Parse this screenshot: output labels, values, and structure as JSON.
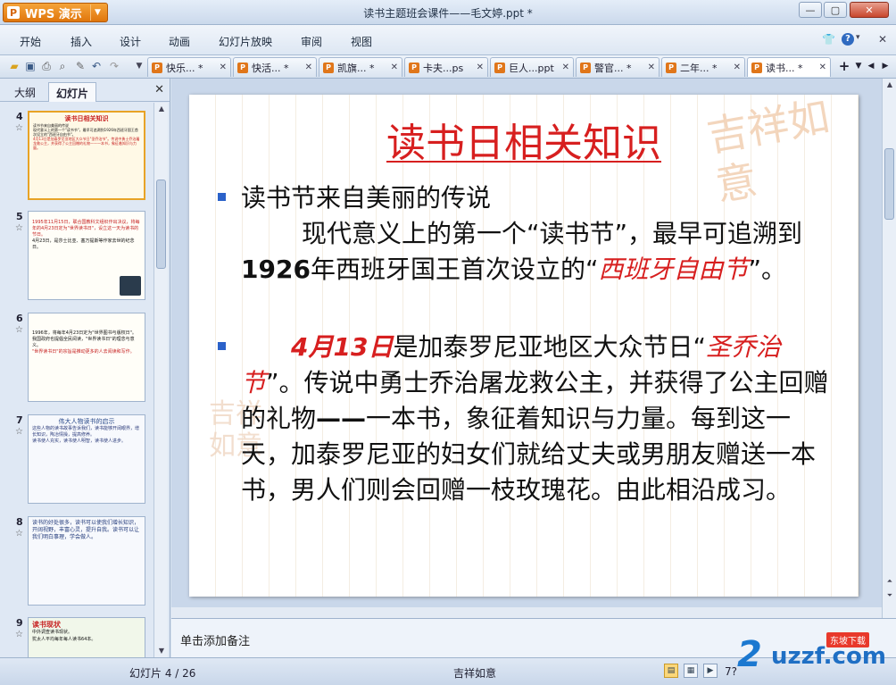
{
  "app": {
    "name": "WPS 演示",
    "doc_title": "读书主题班会课件——毛文婷.ppt *"
  },
  "window_controls": {
    "minimize": "—",
    "maximize": "▢",
    "close": "✕"
  },
  "menu": [
    "开始",
    "插入",
    "设计",
    "动画",
    "幻灯片放映",
    "审阅",
    "视图"
  ],
  "menu_right": {
    "shirt": "👕",
    "help": "?",
    "help_caret": "▾",
    "close_small": "✕"
  },
  "tabs": [
    {
      "label": "快乐... *",
      "active": false
    },
    {
      "label": "快活... *",
      "active": false
    },
    {
      "label": "凯旗... *",
      "active": false
    },
    {
      "label": "卡夫...ps",
      "active": false
    },
    {
      "label": "巨人...ppt",
      "active": false
    },
    {
      "label": "警官... *",
      "active": false
    },
    {
      "label": "二年... *",
      "active": false
    },
    {
      "label": "读书... *",
      "active": true
    }
  ],
  "panel": {
    "tab_outline": "大纲",
    "tab_slides": "幻灯片",
    "close": "✕"
  },
  "thumbnails": [
    {
      "num": "4",
      "title": "读书日相关知识",
      "lines": [
        "读书节来自美丽的传说",
        "现代意义上的第一个\"读书节\"，最早可追溯到1926年西班牙国王首次设立的\"西班牙自由节\"。",
        "4月13日是加泰罗尼亚地区大众节日\"圣乔治节\"。传说中勇士乔治屠龙救公主，并获得了公主回赠的礼物——一本书，象征着知识与力量。"
      ]
    },
    {
      "num": "5",
      "title": "",
      "lines": [
        "1995年11月15日，联合国教科文组织作出决议，将每年的4月23日定为\"世界读书日\"，设立这一天为读书的节日。",
        "4月23日，是莎士比亚、塞万提斯等作家去世的纪念日。"
      ]
    },
    {
      "num": "6",
      "title": "",
      "lines": [
        "1996年，将每年4月23日定为\"世界图书与版权日\"。",
        "我国政府也提倡全民阅读，\"世界读书日\"的理念与意义。",
        "\"世界读书日\"的宗旨是推动更多的人去阅读和写作。"
      ]
    },
    {
      "num": "7",
      "title": "伟大人物读书的启示",
      "lines": [
        "这些人物的读书故事告诉我们，读书能够开阔眼界，增长知识，陶冶情操，提高修养。",
        "读书使人充实，读书使人明智，读书使人进步。"
      ]
    },
    {
      "num": "8",
      "title": "",
      "lines": [
        "读书的好处很多，读书可以使我们增长知识，开阔视野，丰富心灵，提升自我。读书可以让我们明白事理，学会做人。"
      ]
    },
    {
      "num": "9",
      "title": "读书现状",
      "lines": [
        "中外调查读书现状。",
        "犹太人平均每年每人读书64本。"
      ]
    }
  ],
  "slide": {
    "title": "读书日相关知识",
    "seal_text": "吉祥如意",
    "bullet1": {
      "heading": "读书节来自美丽的传说",
      "p1": "现代意义上的第一个“读书节”，最早可追溯到",
      "year": "1926",
      "p2": "年西班牙国王首次设立的“",
      "red": "西班牙自由节",
      "p3": "”。"
    },
    "bullet2": {
      "date": "4月13日",
      "p1": "是加泰罗尼亚地区大众节日“",
      "red": "圣乔治节",
      "p2": "”。传说中勇士乔治屠龙救公主，并获得了公主回赠的礼物",
      "dash": "——",
      "p3": "一本书，象征着知识与力量。每到这一天，加泰罗尼亚的妇女们就给丈夫或男朋友赠送一本书，男人们则会回赠一枝玫瑰花。由此相沿成习。"
    }
  },
  "notes_placeholder": "单击添加备注",
  "status": {
    "slide_counter": "幻灯片 4 / 26",
    "theme": "吉祥如意",
    "zoom": "7?"
  },
  "watermark": {
    "logo": "2",
    "site": "uzzf.com",
    "tag": "东坡下载"
  },
  "colors": {
    "accent_red": "#d71f1f",
    "bullet_blue": "#2b62c9",
    "wps_orange": "#e0760c"
  }
}
